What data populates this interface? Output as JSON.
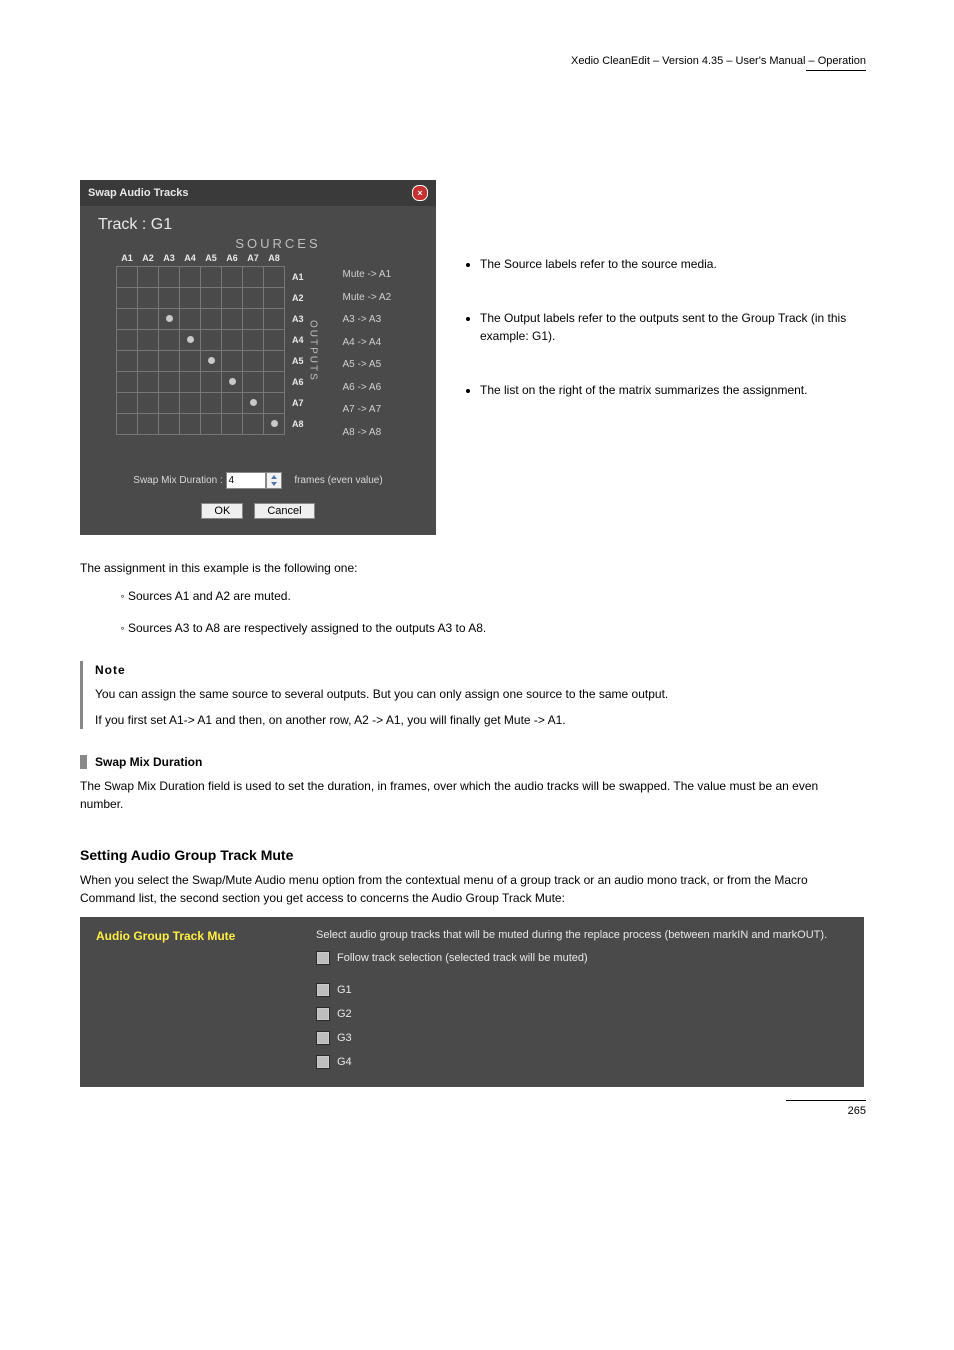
{
  "header": {
    "book_ref": "Xedio CleanEdit – Version 4.35 – User's Manual – Operation"
  },
  "dialog": {
    "title": "Swap Audio Tracks",
    "track_label": "Track : G1",
    "sources_label": "SOURCES",
    "outputs_label": "OUTPUTS",
    "sources": [
      "A1",
      "A2",
      "A3",
      "A4",
      "A5",
      "A6",
      "A7",
      "A8"
    ],
    "outputs": [
      "A1",
      "A2",
      "A3",
      "A4",
      "A5",
      "A6",
      "A7",
      "A8"
    ],
    "mappings": [
      "Mute -> A1",
      "Mute -> A2",
      "A3 -> A3",
      "A4 -> A4",
      "A5 -> A5",
      "A6 -> A6",
      "A7 -> A7",
      "A8 -> A8"
    ],
    "dots": [
      [
        2,
        2
      ],
      [
        3,
        3
      ],
      [
        4,
        4
      ],
      [
        5,
        5
      ],
      [
        6,
        6
      ],
      [
        7,
        7
      ]
    ],
    "swap_label": "Swap Mix Duration :",
    "swap_value": "4",
    "swap_unit": "frames (even value)",
    "ok": "OK",
    "cancel": "Cancel"
  },
  "bullets_side": {
    "b1": "The Source labels refer to the source media.",
    "b2": "The Output labels refer to the outputs sent to the Group Track (in this example: G1).",
    "b3": "The list on the right of the matrix summarizes the assignment."
  },
  "matrix_text": {
    "intro": "The assignment in this example is the following one:",
    "li1": "Sources A1 and A2 are muted.",
    "li2": "Sources A3 to A8 are respectively assigned to the outputs A3 to A8."
  },
  "note": {
    "label": "Note",
    "text1": "You can assign the same source to several outputs. But you can only assign one source to the same output.",
    "text2": "If you first set A1-> A1 and then, on another row, A2 -> A1, you will finally get Mute -> A1."
  },
  "swap_para": {
    "head": "Swap Mix Duration",
    "text": "The Swap Mix Duration field is used to set the duration, in frames, over which the audio tracks will be swapped. The value must be an even number."
  },
  "mute_sec": {
    "head": "Setting Audio Group Track Mute",
    "intro": "When you select the Swap/Mute Audio menu option from the contextual menu of a group track or an audio mono track, or from the Macro Command list, the second section you get access to concerns the Audio Group Track Mute:"
  },
  "mute_panel": {
    "title": "Audio Group Track Mute",
    "desc": "Select audio group tracks that will be muted during the replace process (between markIN and markOUT).",
    "follow": "Follow track selection (selected track will be muted)",
    "g1": "G1",
    "g2": "G2",
    "g3": "G3",
    "g4": "G4"
  },
  "footer": {
    "page": "265"
  }
}
